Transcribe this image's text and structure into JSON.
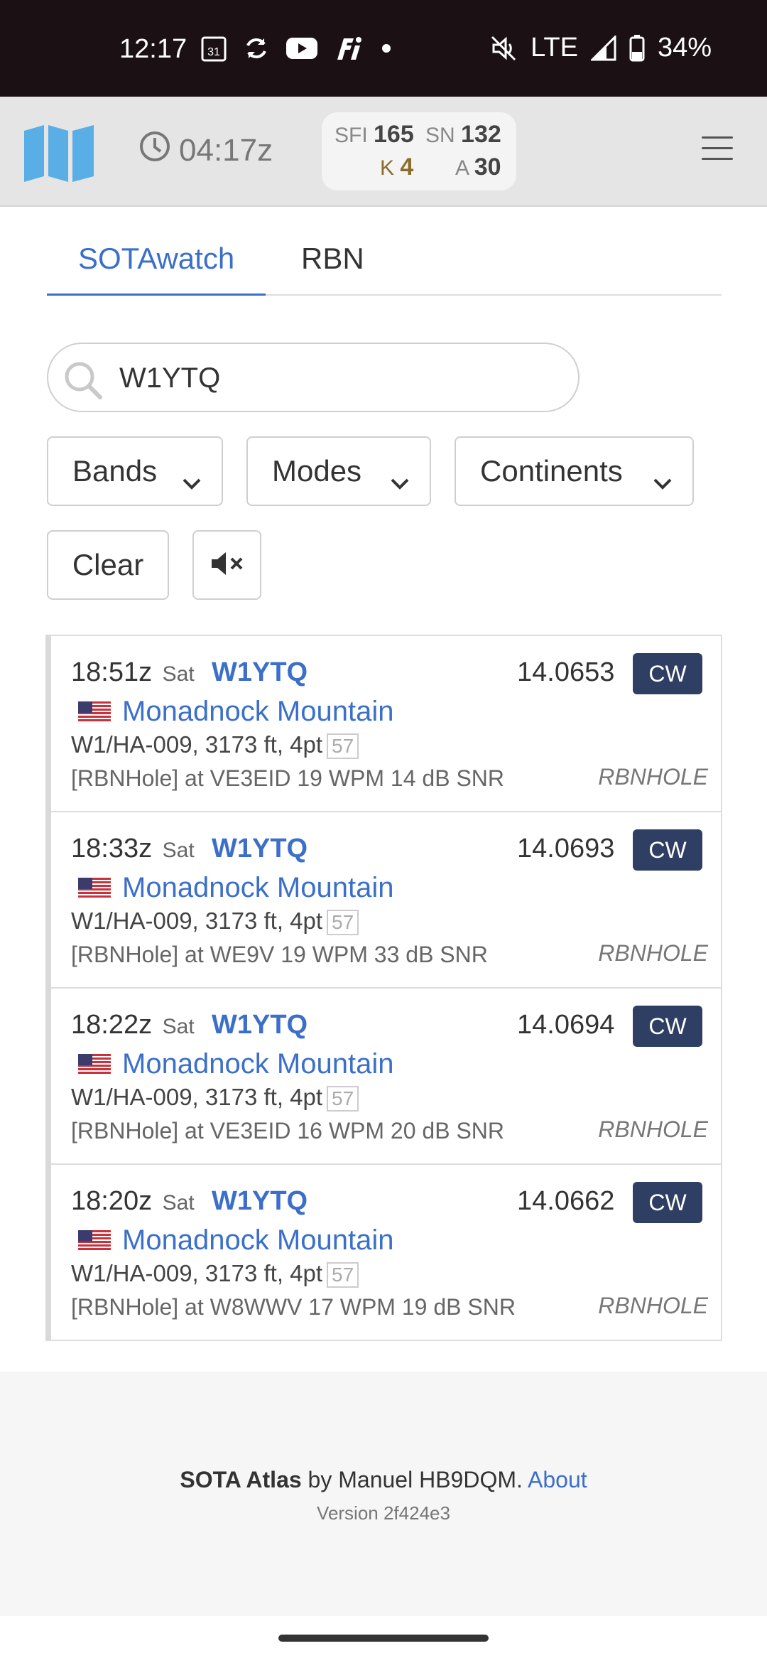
{
  "status_bar": {
    "time": "12:17",
    "network": "LTE",
    "battery": "34%",
    "icons": [
      "calendar-icon",
      "sync-icon",
      "youtube-icon",
      "fi-icon",
      "dot-icon",
      "mute-icon",
      "signal-icon",
      "battery-icon"
    ]
  },
  "header": {
    "utc_time": "04:17z",
    "solar": {
      "sfi_label": "SFI",
      "sfi_value": "165",
      "sn_label": "SN",
      "sn_value": "132",
      "k_label": "K",
      "k_value": "4",
      "a_label": "A",
      "a_value": "30"
    },
    "icons": [
      "map-logo-icon",
      "clock-icon",
      "menu-icon"
    ]
  },
  "tabs": [
    {
      "label": "SOTAwatch",
      "active": true
    },
    {
      "label": "RBN",
      "active": false
    }
  ],
  "filters": {
    "search_value": "W1YTQ",
    "bands_label": "Bands",
    "modes_label": "Modes",
    "continents_label": "Continents",
    "clear_label": "Clear"
  },
  "spots": [
    {
      "time": "18:51z",
      "day": "Sat",
      "callsign": "W1YTQ",
      "frequency": "14.0653",
      "mode": "CW",
      "summit": "Monadnock Mountain",
      "reference": "W1/HA-009, 3173 ft, 4pt",
      "age": "57",
      "comment": "[RBNHole] at VE3EID 19 WPM 14 dB SNR",
      "source": "RBNHOLE"
    },
    {
      "time": "18:33z",
      "day": "Sat",
      "callsign": "W1YTQ",
      "frequency": "14.0693",
      "mode": "CW",
      "summit": "Monadnock Mountain",
      "reference": "W1/HA-009, 3173 ft, 4pt",
      "age": "57",
      "comment": "[RBNHole] at WE9V 19 WPM 33 dB SNR",
      "source": "RBNHOLE"
    },
    {
      "time": "18:22z",
      "day": "Sat",
      "callsign": "W1YTQ",
      "frequency": "14.0694",
      "mode": "CW",
      "summit": "Monadnock Mountain",
      "reference": "W1/HA-009, 3173 ft, 4pt",
      "age": "57",
      "comment": "[RBNHole] at VE3EID 16 WPM 20 dB SNR",
      "source": "RBNHOLE"
    },
    {
      "time": "18:20z",
      "day": "Sat",
      "callsign": "W1YTQ",
      "frequency": "14.0662",
      "mode": "CW",
      "summit": "Monadnock Mountain",
      "reference": "W1/HA-009, 3173 ft, 4pt",
      "age": "57",
      "comment": "[RBNHole] at W8WWV 17 WPM 19 dB SNR",
      "source": "RBNHOLE"
    }
  ],
  "footer": {
    "app_name": "SOTA Atlas",
    "by_text": " by Manuel HB9DQM. ",
    "about_label": "About",
    "version": "Version 2f424e3"
  },
  "colors": {
    "accent": "#3b6fc9",
    "mode_badge": "#2f3f64",
    "status_bar": "#1b1114",
    "header_bg": "#e5e5e5",
    "logo": "#5aaee6"
  }
}
